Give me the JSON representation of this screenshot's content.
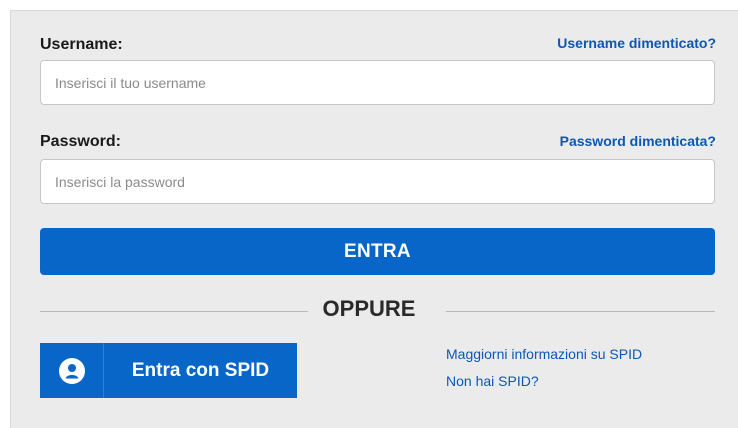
{
  "username": {
    "label": "Username:",
    "forgot_link": "Username dimenticato?",
    "placeholder": "Inserisci il tuo username",
    "value": ""
  },
  "password": {
    "label": "Password:",
    "forgot_link": "Password dimenticata?",
    "placeholder": "Inserisci la password",
    "value": ""
  },
  "login_button": {
    "label": "ENTRA"
  },
  "separator": {
    "label": "OPPURE"
  },
  "spid": {
    "button_label": "Entra con SPID",
    "icon": "user-avatar-icon",
    "more_info_link": "Maggiorni informazioni su SPID",
    "no_spid_link": "Non hai SPID?"
  },
  "colors": {
    "primary": "#0966c9",
    "link": "#0b57b3",
    "panel_background": "#ebebeb"
  }
}
